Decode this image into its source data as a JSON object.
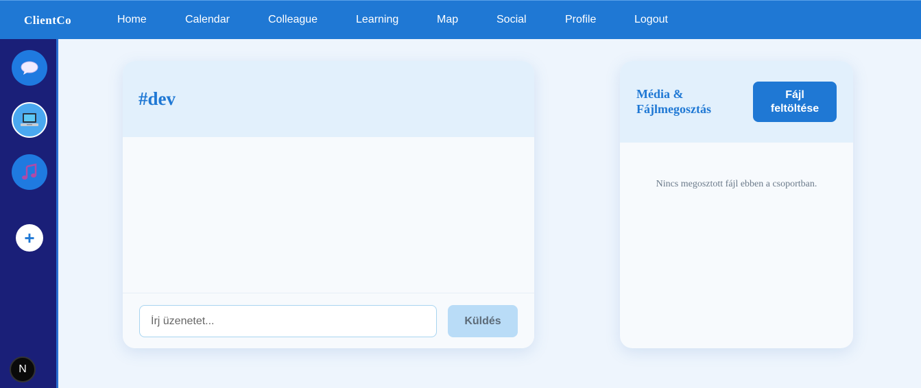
{
  "app": {
    "brand": "ClientCo"
  },
  "nav": {
    "items": [
      {
        "label": "Home"
      },
      {
        "label": "Calendar"
      },
      {
        "label": "Colleague"
      },
      {
        "label": "Learning"
      },
      {
        "label": "Map"
      },
      {
        "label": "Social"
      },
      {
        "label": "Profile"
      },
      {
        "label": "Logout"
      }
    ]
  },
  "sidebar": {
    "servers": [
      {
        "icon": "speech-bubble-icon",
        "active": false
      },
      {
        "icon": "laptop-icon",
        "active": true
      },
      {
        "icon": "music-note-icon",
        "active": false
      }
    ],
    "add_label": "+",
    "user_badge": "N"
  },
  "chat": {
    "channel": "#dev",
    "input_placeholder": "Írj üzenetet...",
    "send_label": "Küldés"
  },
  "media": {
    "title": "Média & Fájlmegosztás",
    "upload_label": "Fájl feltöltése",
    "empty_text": "Nincs megosztott fájl ebben a csoportban."
  },
  "colors": {
    "primary": "#1f78d4",
    "sidebar": "#1a1f78",
    "header_bg": "#e2f0fc",
    "send_disabled": "#b9dcf7"
  }
}
